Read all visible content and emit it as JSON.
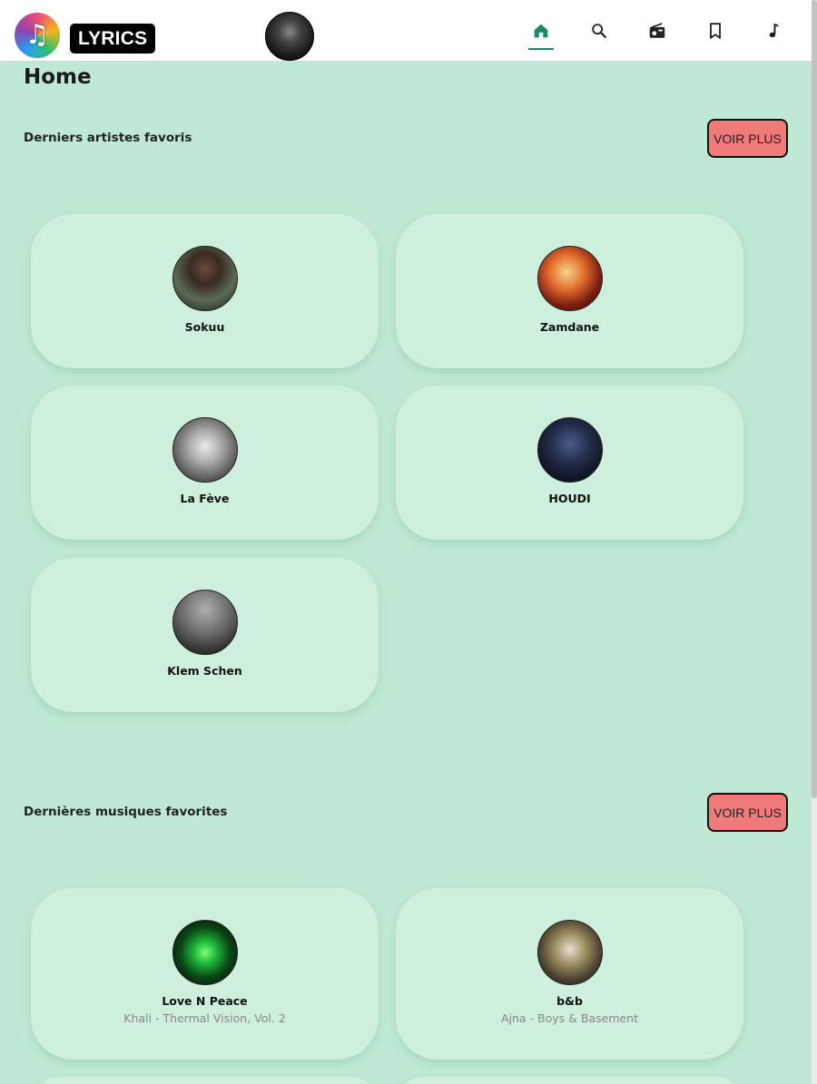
{
  "app": {
    "brand": "LYRICS",
    "logo_icon": "♫"
  },
  "nav": [
    {
      "icon": "home-icon",
      "active": true
    },
    {
      "icon": "search-icon",
      "active": false
    },
    {
      "icon": "radio-icon",
      "active": false
    },
    {
      "icon": "bookmark-icon",
      "active": false
    },
    {
      "icon": "music-note-icon",
      "active": false
    }
  ],
  "colors": {
    "background": "#bfe9d4",
    "card": "#cdefdc",
    "accent": "#1b8a63",
    "button": "#f07a7a"
  },
  "page": {
    "title": "Home"
  },
  "favorite_artists": {
    "title": "Derniers artistes favoris",
    "more_label": "VOIR PLUS",
    "items": [
      {
        "name": "Sokuu"
      },
      {
        "name": "Zamdane"
      },
      {
        "name": "La Fève"
      },
      {
        "name": "HOUDI"
      },
      {
        "name": "Klem Schen"
      }
    ]
  },
  "favorite_tracks": {
    "title": "Dernières musiques favorites",
    "more_label": "VOIR PLUS",
    "items": [
      {
        "name": "Love N Peace",
        "subtitle": "Khali - Thermal Vision, Vol. 2"
      },
      {
        "name": "b&b",
        "subtitle": "Ajna - Boys & Basement"
      }
    ]
  }
}
